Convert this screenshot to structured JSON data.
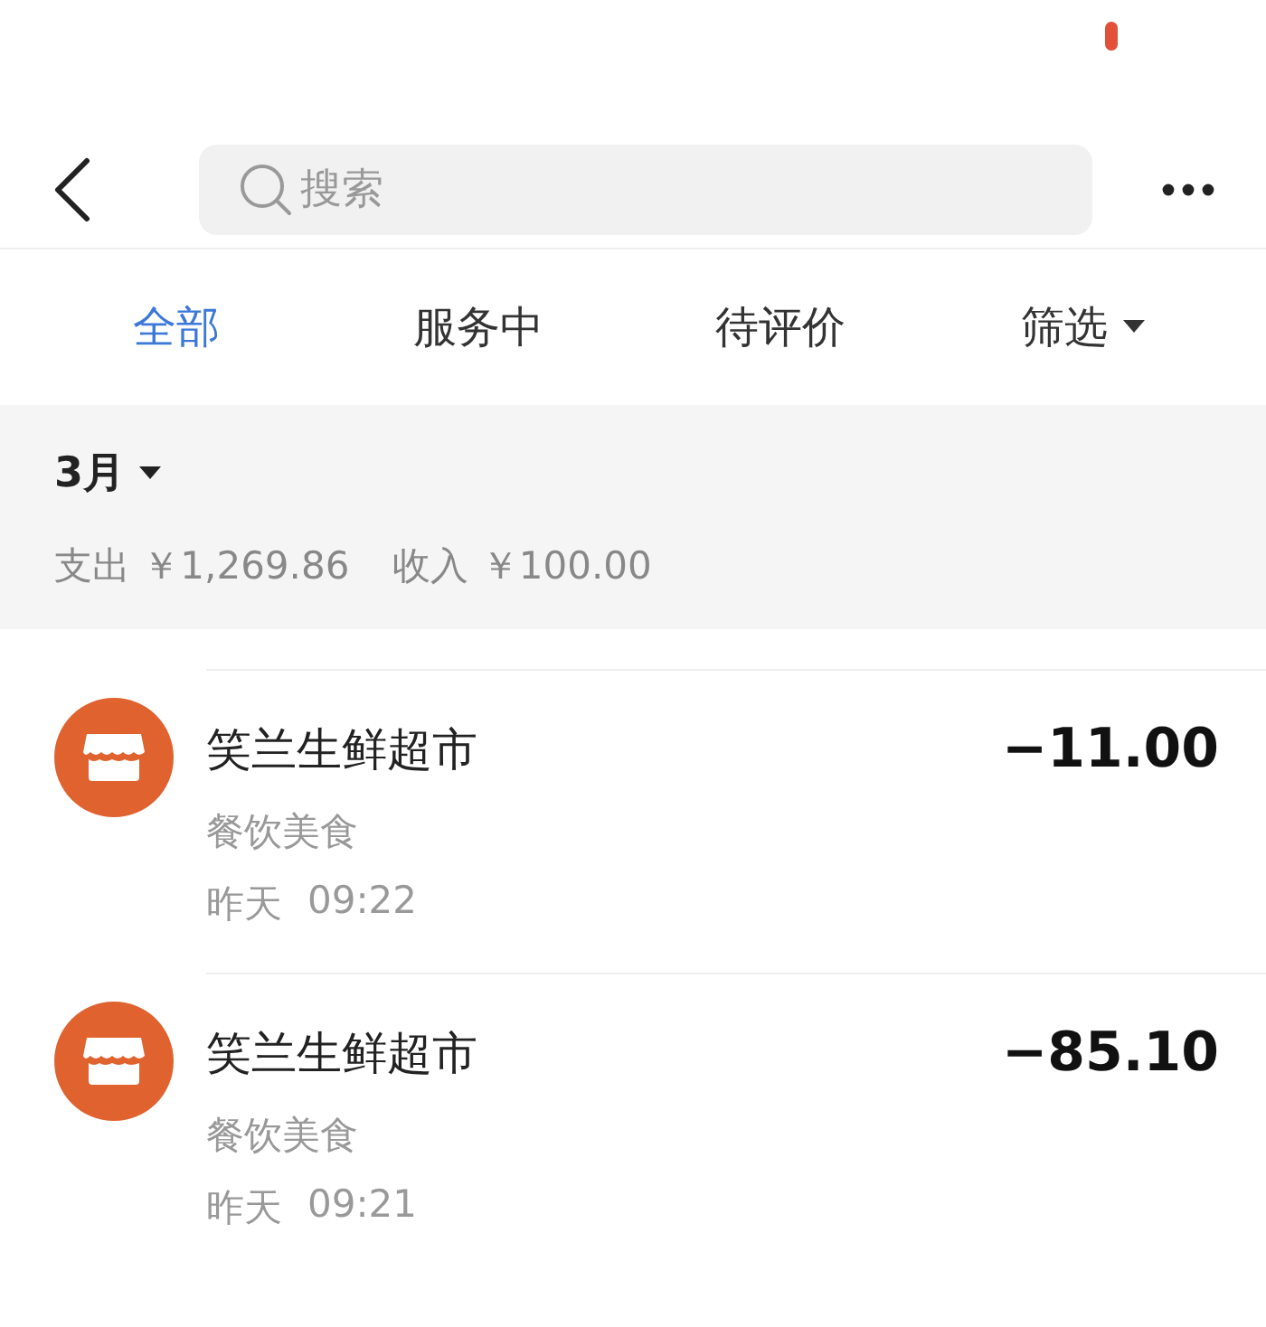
{
  "header": {
    "search": {
      "placeholder": "搜索"
    }
  },
  "tabs": [
    {
      "label": "全部",
      "selected": true
    },
    {
      "label": "服务中",
      "selected": false
    },
    {
      "label": "待评价",
      "selected": false
    }
  ],
  "filter": {
    "label": "筛选"
  },
  "summary": {
    "month": "3月",
    "expense": "支出 ￥1,269.86",
    "income": "收入 ￥100.00"
  },
  "transactions": [
    {
      "merchant": "笑兰生鲜超市",
      "category": "餐饮美食",
      "day": "昨天",
      "time": "09:22",
      "amount": "−11.00"
    },
    {
      "merchant": "笑兰生鲜超市",
      "category": "餐饮美食",
      "day": "昨天",
      "time": "09:21",
      "amount": "−85.10"
    }
  ]
}
